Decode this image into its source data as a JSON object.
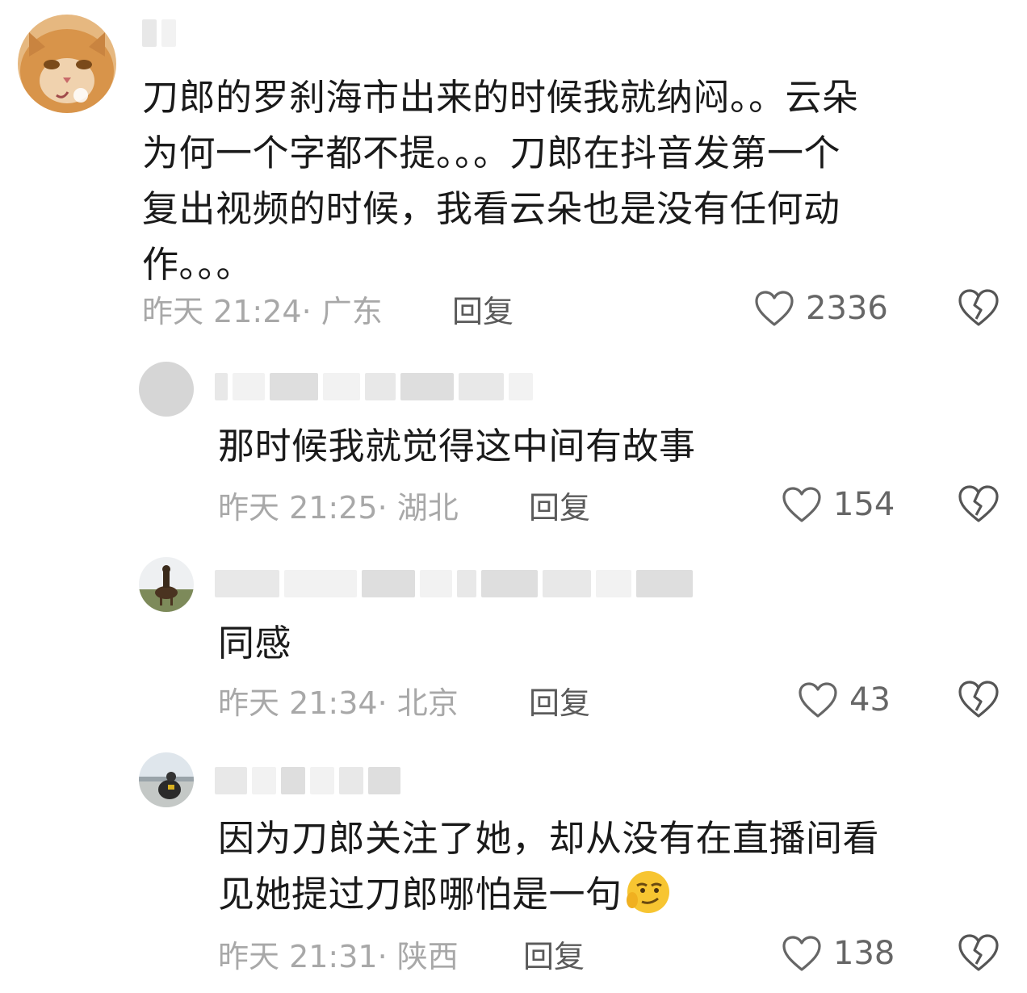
{
  "comments": [
    {
      "text_lines": [
        "刀郎的罗刹海市出来的时候我就纳闷。。云朵",
        "为何一个字都不提。。。刀郎在抖音发第一个",
        "复出视频的时候，我看云朵也是没有任何动",
        "作。。。"
      ],
      "meta": "昨天 21:24· 广东",
      "reply_label": "回复",
      "likes": "2336",
      "avatar_icon": "cat-avatar-icon"
    },
    {
      "text_lines": [
        "那时候我就觉得这中间有故事"
      ],
      "meta": "昨天 21:25· 湖北",
      "reply_label": "回复",
      "likes": "154",
      "avatar_icon": "gray-avatar-icon"
    },
    {
      "text_lines": [
        "同感"
      ],
      "meta": "昨天 21:34· 北京",
      "reply_label": "回复",
      "likes": "43",
      "avatar_icon": "horse-rider-avatar-icon"
    },
    {
      "text_lines": [
        "因为刀郎关注了她，却从没有在直播间看",
        "见她提过刀郎哪怕是一句"
      ],
      "meta": "昨天 21:31· 陕西",
      "reply_label": "回复",
      "likes": "138",
      "avatar_icon": "landscape-avatar-icon",
      "emoji": "smirk-emoji-icon"
    }
  ],
  "colors": {
    "text": "#1a1a1a",
    "meta": "#a8a8a8",
    "reply": "#5a5a5a",
    "icon": "#666666"
  }
}
